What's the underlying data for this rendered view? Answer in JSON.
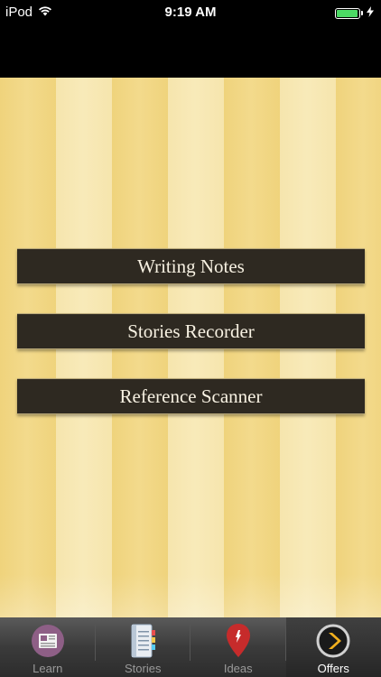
{
  "status_bar": {
    "carrier": "iPod",
    "time": "9:19 AM",
    "battery_level": 0.95
  },
  "menu": {
    "items": [
      {
        "label": "Writing Notes"
      },
      {
        "label": "Stories Recorder"
      },
      {
        "label": "Reference Scanner"
      }
    ]
  },
  "tab_bar": {
    "tabs": [
      {
        "label": "Learn",
        "icon": "newspaper-icon"
      },
      {
        "label": "Stories",
        "icon": "notebook-icon"
      },
      {
        "label": "Ideas",
        "icon": "map-pin-icon"
      },
      {
        "label": "Offers",
        "icon": "chevron-circle-icon"
      }
    ],
    "selected": "Offers"
  },
  "colors": {
    "button_bg": "#2e2921",
    "button_text": "#f7f1e2",
    "stripe_dark": "#efd37c",
    "stripe_light": "#f6e5ad",
    "battery_green": "#4cd964",
    "tab_bar_bg": "#3b3b3b"
  }
}
